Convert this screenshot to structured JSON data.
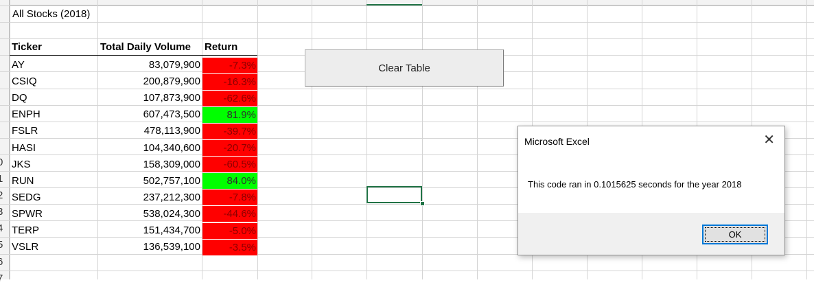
{
  "sheet": {
    "title": "All Stocks (2018)",
    "headers": {
      "ticker": "Ticker",
      "volume": "Total Daily Volume",
      "return": "Return"
    },
    "row_numbers": [
      "",
      "",
      "",
      "",
      "",
      "",
      "",
      "",
      "",
      "0",
      "1",
      "2",
      "3",
      "4",
      "5",
      "6",
      "7"
    ],
    "rows": [
      {
        "ticker": "AY",
        "volume": "83,079,900",
        "return": "-7.3%",
        "status": "negative"
      },
      {
        "ticker": "CSIQ",
        "volume": "200,879,900",
        "return": "-16.3%",
        "status": "negative"
      },
      {
        "ticker": "DQ",
        "volume": "107,873,900",
        "return": "-62.6%",
        "status": "negative"
      },
      {
        "ticker": "ENPH",
        "volume": "607,473,500",
        "return": "81.9%",
        "status": "positive"
      },
      {
        "ticker": "FSLR",
        "volume": "478,113,900",
        "return": "-39.7%",
        "status": "negative"
      },
      {
        "ticker": "HASI",
        "volume": "104,340,600",
        "return": "-20.7%",
        "status": "negative"
      },
      {
        "ticker": "JKS",
        "volume": "158,309,000",
        "return": "-60.5%",
        "status": "negative"
      },
      {
        "ticker": "RUN",
        "volume": "502,757,100",
        "return": "84.0%",
        "status": "positive"
      },
      {
        "ticker": "SEDG",
        "volume": "237,212,300",
        "return": "-7.8%",
        "status": "negative"
      },
      {
        "ticker": "SPWR",
        "volume": "538,024,300",
        "return": "-44.6%",
        "status": "negative"
      },
      {
        "ticker": "TERP",
        "volume": "151,434,700",
        "return": "-5.0%",
        "status": "negative"
      },
      {
        "ticker": "VSLR",
        "volume": "136,539,100",
        "return": "-3.5%",
        "status": "negative"
      }
    ],
    "colors": {
      "negative": "#ff0000",
      "positive": "#00ff00",
      "selection": "#217346"
    }
  },
  "button": {
    "clear_label": "Clear Table"
  },
  "dialog": {
    "title": "Microsoft Excel",
    "message": "This code ran in 0.1015625 seconds for the year 2018",
    "ok_label": "OK",
    "close_icon": "close-icon"
  }
}
